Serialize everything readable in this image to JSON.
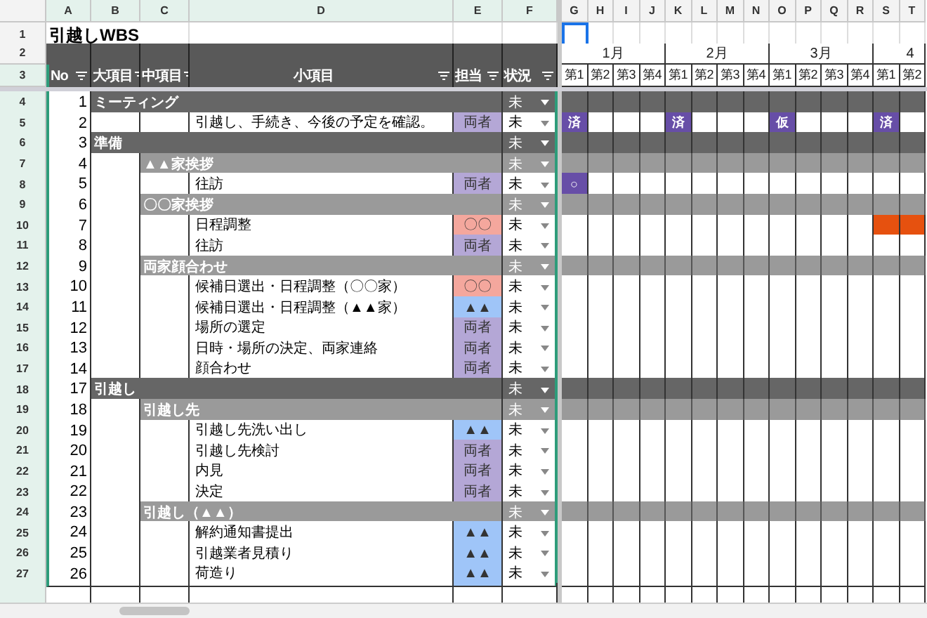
{
  "title_cell": {
    "row": "1",
    "text": "引越しWBS"
  },
  "cursor": {
    "selected": true
  },
  "column_letters": [
    "A",
    "B",
    "C",
    "D",
    "E",
    "F",
    "G",
    "H",
    "I",
    "J",
    "K",
    "L",
    "M",
    "N",
    "O",
    "P",
    "Q",
    "R",
    "S",
    "T"
  ],
  "header_rows": [
    "2",
    "3"
  ],
  "columns": [
    {
      "label": "No"
    },
    {
      "label": "大項目"
    },
    {
      "label": "中項目"
    },
    {
      "label": "小項目"
    },
    {
      "label": "担当"
    },
    {
      "label": "状況"
    }
  ],
  "months": [
    "1月",
    "2月",
    "3月",
    "4"
  ],
  "weeks": [
    "第1",
    "第2",
    "第3",
    "第4",
    "第1",
    "第2",
    "第3",
    "第4",
    "第1",
    "第2",
    "第3",
    "第4",
    "第1",
    "第2"
  ],
  "rows": [
    {
      "row": "4",
      "no": "1",
      "kind": "major",
      "task": "ミーティング",
      "status": "未"
    },
    {
      "row": "5",
      "no": "2",
      "kind": "minor",
      "task": "引越し、手続き、今後の予定を確認。",
      "assignee": {
        "text": "両者",
        "color": "#b4a7d6"
      },
      "status": "未",
      "gantt": [
        {
          "kind": "mark",
          "text": "済",
          "color": "#674ea7"
        },
        {
          "kind": "blank"
        },
        {
          "kind": "blank"
        },
        {
          "kind": "blank"
        },
        {
          "kind": "mark",
          "text": "済",
          "color": "#674ea7"
        },
        {
          "kind": "blank"
        },
        {
          "kind": "blank"
        },
        {
          "kind": "blank"
        },
        {
          "kind": "mark",
          "text": "仮",
          "color": "#674ea7"
        },
        {
          "kind": "blank"
        },
        {
          "kind": "blank"
        },
        {
          "kind": "blank"
        },
        {
          "kind": "mark",
          "text": "済",
          "color": "#674ea7"
        },
        {
          "kind": "blank"
        }
      ]
    },
    {
      "row": "6",
      "no": "3",
      "kind": "major",
      "task": "準備",
      "status": "未"
    },
    {
      "row": "7",
      "no": "4",
      "kind": "middle",
      "task": "▲▲家挨拶",
      "status": "未"
    },
    {
      "row": "8",
      "no": "5",
      "kind": "minor",
      "task": "往訪",
      "assignee": {
        "text": "両者",
        "color": "#b4a7d6"
      },
      "status": "未",
      "gantt": [
        {
          "kind": "mark",
          "text": "○",
          "color": "#674ea7"
        },
        {
          "kind": "blank"
        },
        {
          "kind": "blank"
        },
        {
          "kind": "blank"
        },
        {
          "kind": "blank"
        },
        {
          "kind": "blank"
        },
        {
          "kind": "blank"
        },
        {
          "kind": "blank"
        },
        {
          "kind": "blank"
        },
        {
          "kind": "blank"
        },
        {
          "kind": "blank"
        },
        {
          "kind": "blank"
        },
        {
          "kind": "blank"
        },
        {
          "kind": "blank"
        }
      ]
    },
    {
      "row": "9",
      "no": "6",
      "kind": "middle",
      "task": "〇〇家挨拶",
      "status": "未"
    },
    {
      "row": "10",
      "no": "7",
      "kind": "minor",
      "task": "日程調整",
      "assignee": {
        "text": "〇〇",
        "color": "#f4a79d"
      },
      "status": "未",
      "gantt": [
        {
          "kind": "blank"
        },
        {
          "kind": "blank"
        },
        {
          "kind": "blank"
        },
        {
          "kind": "blank"
        },
        {
          "kind": "blank"
        },
        {
          "kind": "blank"
        },
        {
          "kind": "blank"
        },
        {
          "kind": "blank"
        },
        {
          "kind": "blank"
        },
        {
          "kind": "blank"
        },
        {
          "kind": "blank"
        },
        {
          "kind": "blank"
        },
        {
          "kind": "bar",
          "color": "#e6510f"
        },
        {
          "kind": "bar",
          "color": "#e6510f"
        }
      ]
    },
    {
      "row": "11",
      "no": "8",
      "kind": "minor",
      "task": "往訪",
      "assignee": {
        "text": "両者",
        "color": "#b4a7d6"
      },
      "status": "未"
    },
    {
      "row": "12",
      "no": "9",
      "kind": "middle",
      "task": "両家顔合わせ",
      "status": "未"
    },
    {
      "row": "13",
      "no": "10",
      "kind": "minor",
      "task": "候補日選出・日程調整（〇〇家）",
      "assignee": {
        "text": "〇〇",
        "color": "#f4a79d"
      },
      "status": "未"
    },
    {
      "row": "14",
      "no": "11",
      "kind": "minor",
      "task": "候補日選出・日程調整（▲▲家）",
      "assignee": {
        "text": "▲▲",
        "color": "#9fc5f8"
      },
      "status": "未"
    },
    {
      "row": "15",
      "no": "12",
      "kind": "minor",
      "task": "場所の選定",
      "assignee": {
        "text": "両者",
        "color": "#b4a7d6"
      },
      "status": "未"
    },
    {
      "row": "16",
      "no": "13",
      "kind": "minor",
      "task": "日時・場所の決定、両家連絡",
      "assignee": {
        "text": "両者",
        "color": "#b4a7d6"
      },
      "status": "未"
    },
    {
      "row": "17",
      "no": "14",
      "kind": "minor",
      "task": "顔合わせ",
      "assignee": {
        "text": "両者",
        "color": "#b4a7d6"
      },
      "status": "未"
    },
    {
      "row": "18",
      "no": "17",
      "kind": "major",
      "task": "引越し",
      "status": "未"
    },
    {
      "row": "19",
      "no": "18",
      "kind": "middle",
      "task": "引越し先",
      "status": "未"
    },
    {
      "row": "20",
      "no": "19",
      "kind": "minor",
      "task": "引越し先洗い出し",
      "assignee": {
        "text": "▲▲",
        "color": "#9fc5f8"
      },
      "status": "未"
    },
    {
      "row": "21",
      "no": "20",
      "kind": "minor",
      "task": "引越し先検討",
      "assignee": {
        "text": "両者",
        "color": "#b4a7d6"
      },
      "status": "未"
    },
    {
      "row": "22",
      "no": "21",
      "kind": "minor",
      "task": "内見",
      "assignee": {
        "text": "両者",
        "color": "#b4a7d6"
      },
      "status": "未"
    },
    {
      "row": "23",
      "no": "22",
      "kind": "minor",
      "task": "決定",
      "assignee": {
        "text": "両者",
        "color": "#b4a7d6"
      },
      "status": "未"
    },
    {
      "row": "24",
      "no": "23",
      "kind": "middle",
      "task": "引越し（▲▲）",
      "status": "未"
    },
    {
      "row": "25",
      "no": "24",
      "kind": "minor",
      "task": "解約通知書提出",
      "assignee": {
        "text": "▲▲",
        "color": "#9fc5f8"
      },
      "status": "未"
    },
    {
      "row": "26",
      "no": "25",
      "kind": "minor",
      "task": "引越業者見積り",
      "assignee": {
        "text": "▲▲",
        "color": "#9fc5f8"
      },
      "status": "未"
    },
    {
      "row": "27",
      "no": "26",
      "kind": "minor",
      "task": "荷造り",
      "assignee": {
        "text": "▲▲",
        "color": "#9fc5f8"
      },
      "status": "未"
    }
  ]
}
